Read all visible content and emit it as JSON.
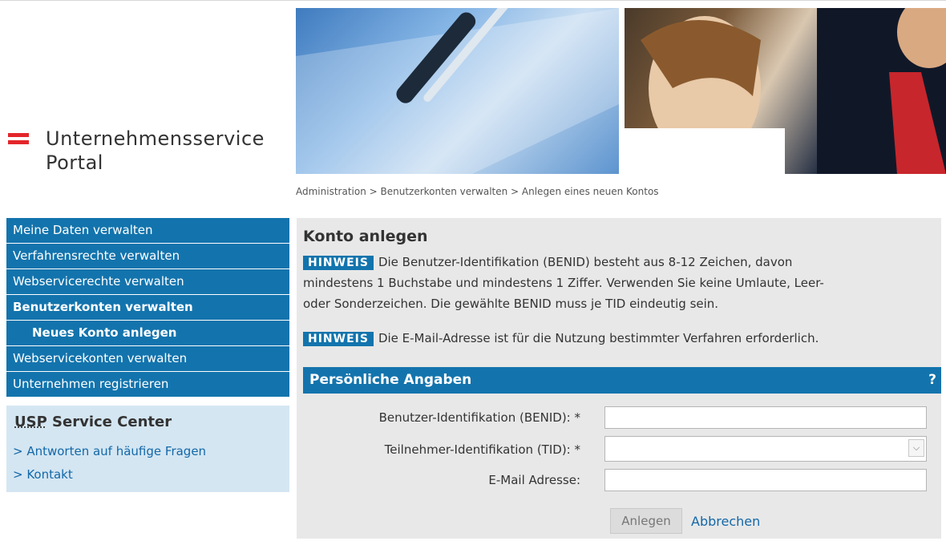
{
  "logo": {
    "line1": "Unternehmensservice",
    "line2": "Portal"
  },
  "breadcrumb": "Administration > Benutzerkonten verwalten > Anlegen eines neuen Kontos",
  "nav": {
    "items": [
      {
        "label": "Meine Daten verwalten"
      },
      {
        "label": "Verfahrensrechte verwalten"
      },
      {
        "label": "Webservicerechte verwalten"
      },
      {
        "label": "Benutzerkonten verwalten"
      },
      {
        "label": "Neues Konto anlegen"
      },
      {
        "label": "Webservicekonten verwalten"
      },
      {
        "label": "Unternehmen registrieren"
      }
    ]
  },
  "service_center": {
    "title_abbr": "USP",
    "title_rest": " Service Center",
    "links": [
      {
        "label": "> Antworten auf häufige Fragen"
      },
      {
        "label": "> Kontakt"
      }
    ]
  },
  "main": {
    "title": "Konto anlegen",
    "hints": [
      {
        "tag": "HINWEIS",
        "line1": "Die Benutzer-Identifikation (BENID) besteht aus 8-12 Zeichen, davon",
        "line2": "mindestens 1 Buchstabe und mindestens 1 Ziffer. Verwenden Sie keine Umlaute, Leer-",
        "line3": "oder Sonderzeichen. Die gewählte BENID muss je TID eindeutig sein."
      },
      {
        "tag": "HINWEIS",
        "line1": "Die E-Mail-Adresse ist für die Nutzung bestimmter Verfahren erforderlich."
      }
    ],
    "section": {
      "title": "Persönliche Angaben",
      "help": "?"
    },
    "form": {
      "benid_label": "Benutzer-Identifikation (BENID): *",
      "benid_value": "",
      "tid_label": "Teilnehmer-Identifikation (TID):  *",
      "tid_value": "",
      "email_label": "E-Mail Adresse:",
      "email_value": ""
    },
    "buttons": {
      "create": "Anlegen",
      "cancel": "Abbrechen"
    }
  },
  "colors": {
    "primary": "#1374ad",
    "sidebar_light": "#d4e6f2",
    "panel_bg": "#e8e8e8",
    "flag_red": "#e3262b",
    "link": "#1368a8"
  }
}
